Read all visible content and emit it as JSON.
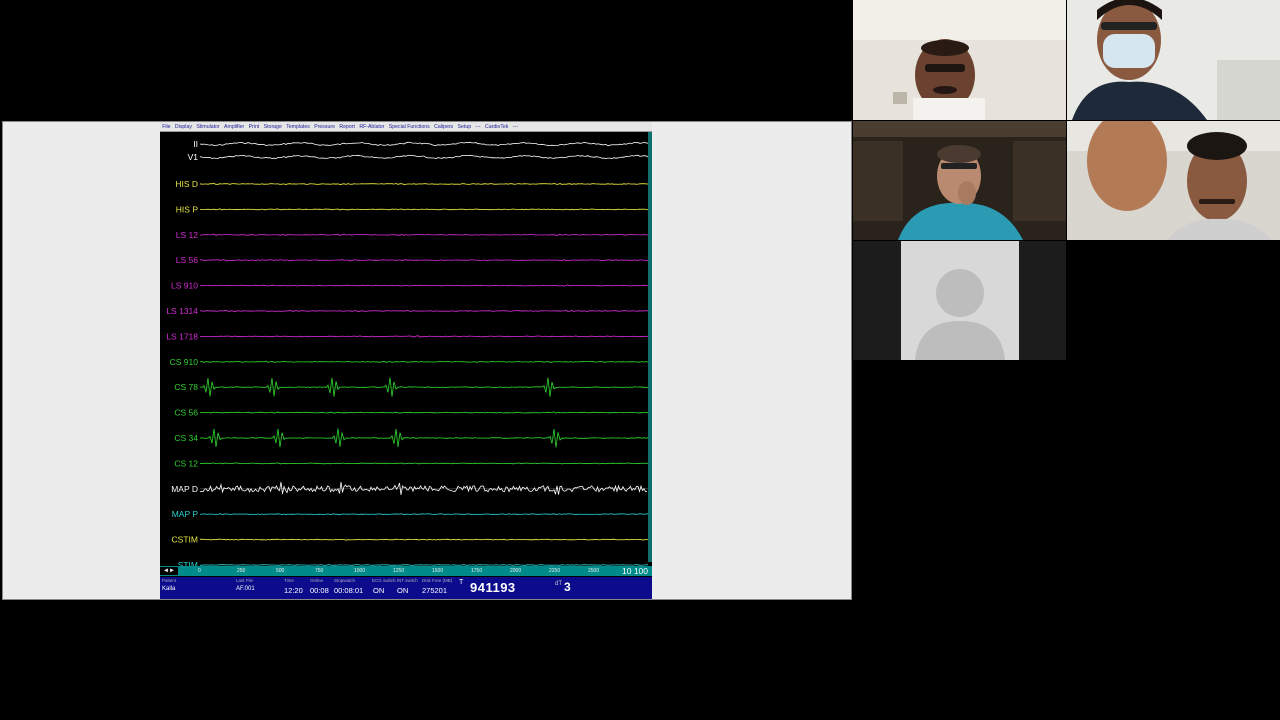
{
  "menu": [
    "File",
    "Display",
    "Stimulator",
    "Amplifier",
    "Print",
    "Storage",
    "Templates",
    "Pressure",
    "Report",
    "RF-Ablator",
    "Special Functions",
    "Calipers",
    "Setup",
    "---",
    "CardioTek",
    "---"
  ],
  "channels": [
    {
      "label": "II",
      "color": "#ffffff"
    },
    {
      "label": "V1",
      "color": "#ffffff"
    },
    {
      "label": "HIS D",
      "color": "#e6e640"
    },
    {
      "label": "HIS P",
      "color": "#e6e640"
    },
    {
      "label": "LS 12",
      "color": "#d22bd2"
    },
    {
      "label": "LS 56",
      "color": "#d22bd2"
    },
    {
      "label": "LS 910",
      "color": "#d22bd2"
    },
    {
      "label": "LS 1314",
      "color": "#d22bd2"
    },
    {
      "label": "LS 1718",
      "color": "#d22bd2"
    },
    {
      "label": "CS 910",
      "color": "#2fd42f"
    },
    {
      "label": "CS 78",
      "color": "#2fd42f"
    },
    {
      "label": "CS 56",
      "color": "#2fd42f"
    },
    {
      "label": "CS 34",
      "color": "#2fd42f"
    },
    {
      "label": "CS 12",
      "color": "#2fd42f"
    },
    {
      "label": "MAP D",
      "color": "#ffffff"
    },
    {
      "label": "MAP P",
      "color": "#2ad0d0"
    },
    {
      "label": "CSTIM",
      "color": "#e6e640"
    },
    {
      "label": "STIM",
      "color": "#2ad0d0"
    }
  ],
  "timebar": {
    "nav": "◄►",
    "ticks": [
      "0",
      "250",
      "500",
      "750",
      "1000",
      "1250",
      "1500",
      "1750",
      "2000",
      "2250",
      "2500"
    ],
    "zoom": "10  100"
  },
  "status": {
    "patient_label": "Patient",
    "patient": "Kalla",
    "lastfile_label": "Last File",
    "lastfile": "AF.001",
    "time_label": "Time",
    "time": "12:20",
    "online_label": "Online",
    "online": "00:08",
    "stopwatch_label": "Stopwatch",
    "stopwatch": "00:08:01",
    "ecg_label": "ECG switch INT switch",
    "ecg": "ON",
    "int": "ON",
    "diskfree_label": "Disk Free (MB)",
    "diskfree": "275201",
    "t_mark": "T",
    "counter": "941193",
    "dt_label": "dT",
    "dt_value": "3"
  },
  "colors": {
    "timebar": "#008a8a",
    "statusbar": "#0b0b8c",
    "grid": "#1f6f1f"
  }
}
